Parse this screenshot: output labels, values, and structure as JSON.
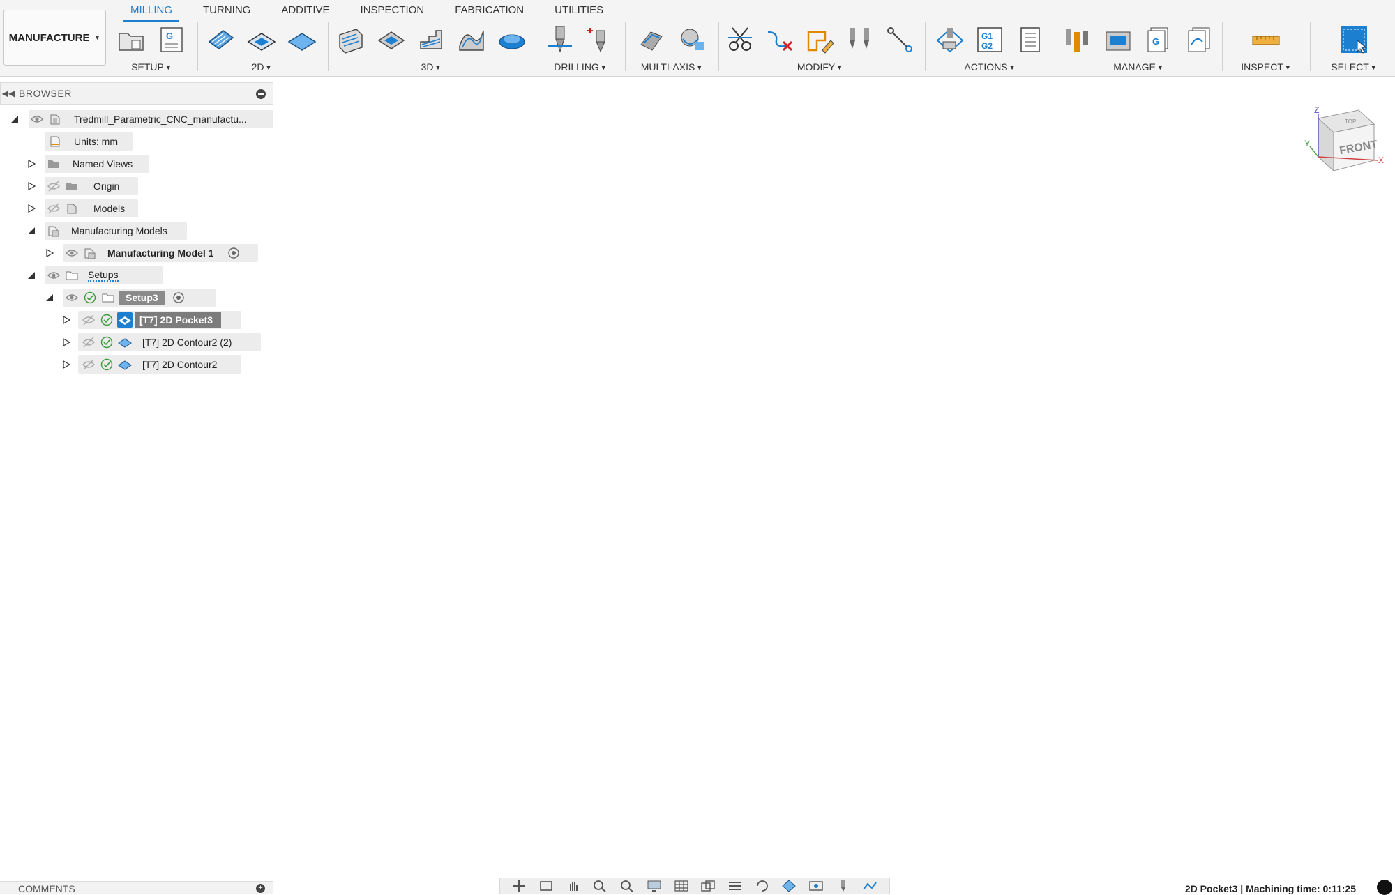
{
  "workspace": {
    "label": "MANUFACTURE"
  },
  "tabs": [
    {
      "label": "MILLING",
      "active": true
    },
    {
      "label": "TURNING",
      "active": false
    },
    {
      "label": "ADDITIVE",
      "active": false
    },
    {
      "label": "INSPECTION",
      "active": false
    },
    {
      "label": "FABRICATION",
      "active": false
    },
    {
      "label": "UTILITIES",
      "active": false
    }
  ],
  "toolbar_groups": [
    {
      "label": "SETUP",
      "icons": [
        "new-setup-icon",
        "nc-program-icon"
      ]
    },
    {
      "label": "2D",
      "icons": [
        "2d-adaptive-icon",
        "2d-pocket-icon",
        "face-icon"
      ]
    },
    {
      "label": "3D",
      "icons": [
        "3d-adaptive-icon",
        "3d-pocket-icon",
        "steep-shallow-icon",
        "scallop-icon",
        "radial-icon"
      ]
    },
    {
      "label": "DRILLING",
      "icons": [
        "drill-icon",
        "hole-recognition-icon"
      ]
    },
    {
      "label": "MULTI-AXIS",
      "icons": [
        "swarf-icon",
        "multi-axis-contour-icon"
      ]
    },
    {
      "label": "MODIFY",
      "icons": [
        "cut-icon",
        "delete-toolpath-icon",
        "edit-boundary-icon",
        "tool-compare-icon",
        "transform-icon"
      ]
    },
    {
      "label": "ACTIONS",
      "icons": [
        "simulate-icon",
        "post-process-icon",
        "setup-sheet-icon"
      ]
    },
    {
      "label": "MANAGE",
      "icons": [
        "tool-library-icon",
        "machine-library-icon",
        "post-library-icon",
        "template-library-icon"
      ]
    },
    {
      "label": "INSPECT",
      "icons": [
        "measure-icon"
      ]
    },
    {
      "label": "SELECT",
      "icons": [
        "window-select-icon"
      ]
    }
  ],
  "accent_color": "#1c7fd0",
  "browser": {
    "title": "BROWSER",
    "root": "Tredmill_Parametric_CNC_manufactu...",
    "units": "Units: mm",
    "named_views": "Named Views",
    "origin": "Origin",
    "models": "Models",
    "manufacturing_models": "Manufacturing Models",
    "manufacturing_model_1": "Manufacturing Model 1",
    "setups": "Setups",
    "setup3": "Setup3",
    "operations": [
      {
        "label": "[T7] 2D Pocket3",
        "selected": true
      },
      {
        "label": "[T7] 2D Contour2 (2)",
        "selected": false
      },
      {
        "label": "[T7] 2D Contour2",
        "selected": false
      }
    ]
  },
  "viewcube": {
    "face": "FRONT",
    "top": "TOP",
    "axis_z": "Z",
    "axis_x": "X",
    "axis_y": "Y"
  },
  "triad": {
    "z": "Z",
    "x": "X"
  },
  "stock_color": "#1f7a1f",
  "toolpath_color": "#e8f03a",
  "comments": {
    "label": "COMMENTS"
  },
  "status": {
    "text": "2D Pocket3 | Machining time: 0:11:25"
  }
}
